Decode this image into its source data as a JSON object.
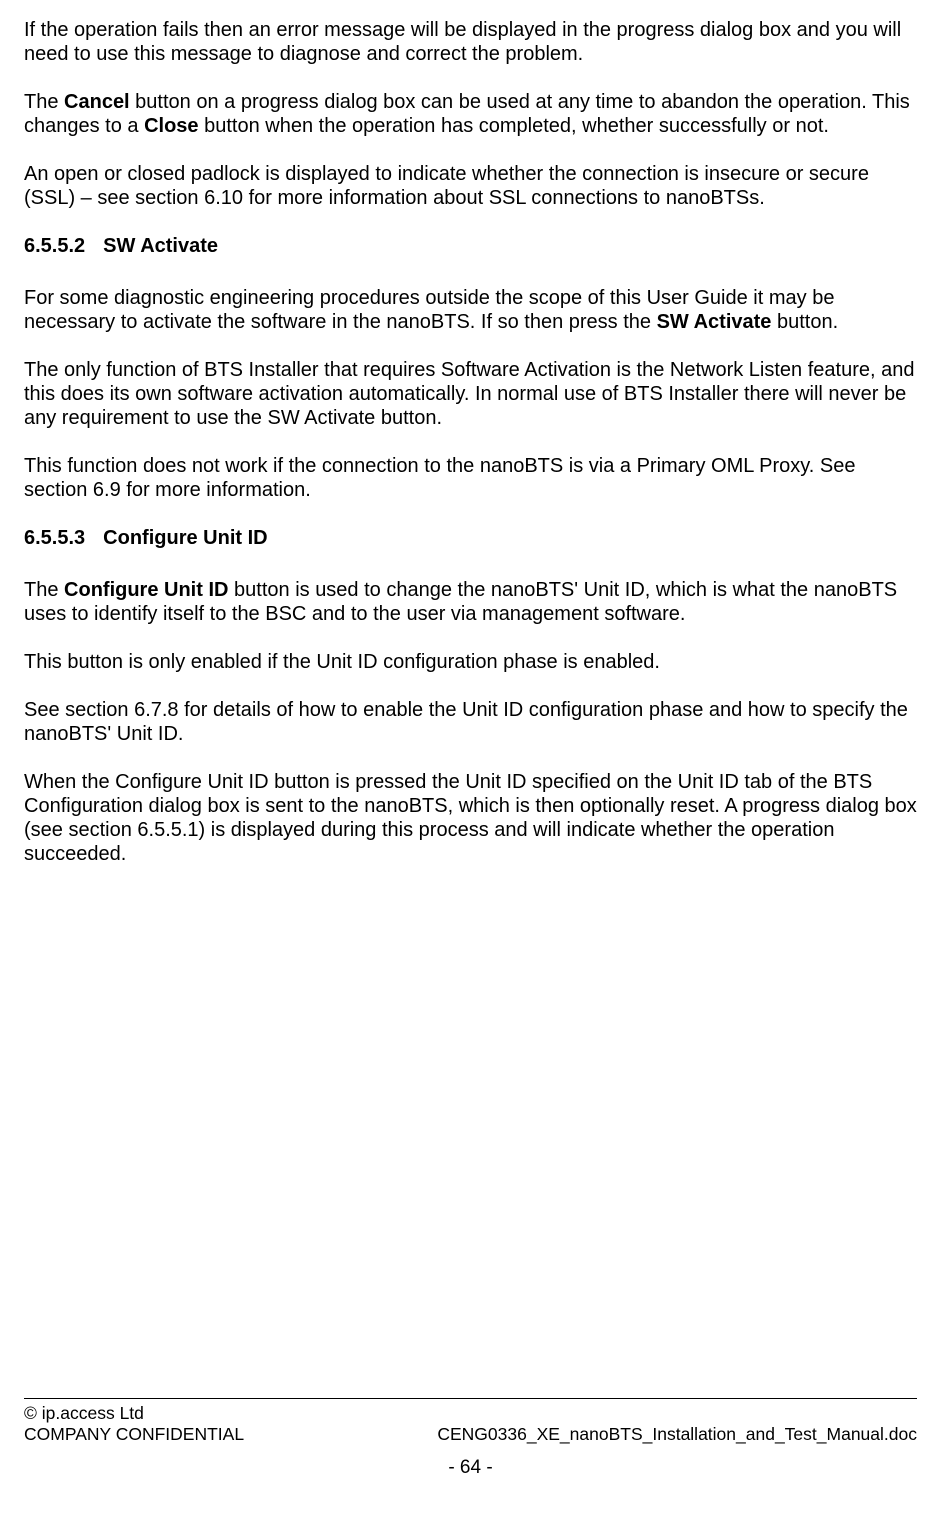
{
  "body": {
    "p1_a": "If the operation fails then an error message will be displayed in the progress dialog box and you will need to use this message to diagnose and correct the problem.",
    "p2_a": "The ",
    "p2_b_bold": "Cancel",
    "p2_c": " button on a progress dialog box can be used at any time to abandon the operation. This changes to a ",
    "p2_d_bold": "Close",
    "p2_e": " button when the operation has completed, whether successfully or not.",
    "p3": "An open or closed padlock is displayed to indicate whether the connection is insecure or secure (SSL) – see section 6.10 for more information about SSL connections to nanoBTSs.",
    "h1_num": "6.5.5.2",
    "h1_title": "SW Activate",
    "p4_a": "For some diagnostic engineering procedures outside the scope of this User Guide it may be necessary to activate the software in the nanoBTS. If so then press the ",
    "p4_b_bold": "SW Activate",
    "p4_c": " button.",
    "p5": "The only function of BTS Installer that requires Software Activation is the Network Listen feature, and this does its own software activation automatically. In normal use of BTS Installer there will never be any requirement to use the SW Activate button.",
    "p6": "This function does not work if the connection to the nanoBTS is via a Primary OML Proxy. See section 6.9 for more information.",
    "h2_num": "6.5.5.3",
    "h2_title": "Configure Unit ID",
    "p7_a": "The ",
    "p7_b_bold": "Configure Unit ID",
    "p7_c": " button is used to change the nanoBTS' Unit ID, which is what the nanoBTS uses to identify itself to the BSC and to the user via management software.",
    "p8": "This button is only enabled if the Unit ID configuration phase is enabled.",
    "p9": "See section 6.7.8 for details of how to enable the Unit ID configuration phase and how to specify the nanoBTS' Unit ID.",
    "p10": "When the Configure Unit ID button is pressed the Unit ID specified on the Unit ID tab of the BTS Configuration dialog box is sent to the nanoBTS, which is then optionally reset. A progress dialog box (see section 6.5.5.1) is displayed during this process and will indicate whether the operation succeeded."
  },
  "footer": {
    "copyright": "© ip.access Ltd",
    "confidentiality": "COMPANY CONFIDENTIAL",
    "doc_name": "CENG0336_XE_nanoBTS_Installation_and_Test_Manual.doc",
    "page": "- 64 -"
  }
}
